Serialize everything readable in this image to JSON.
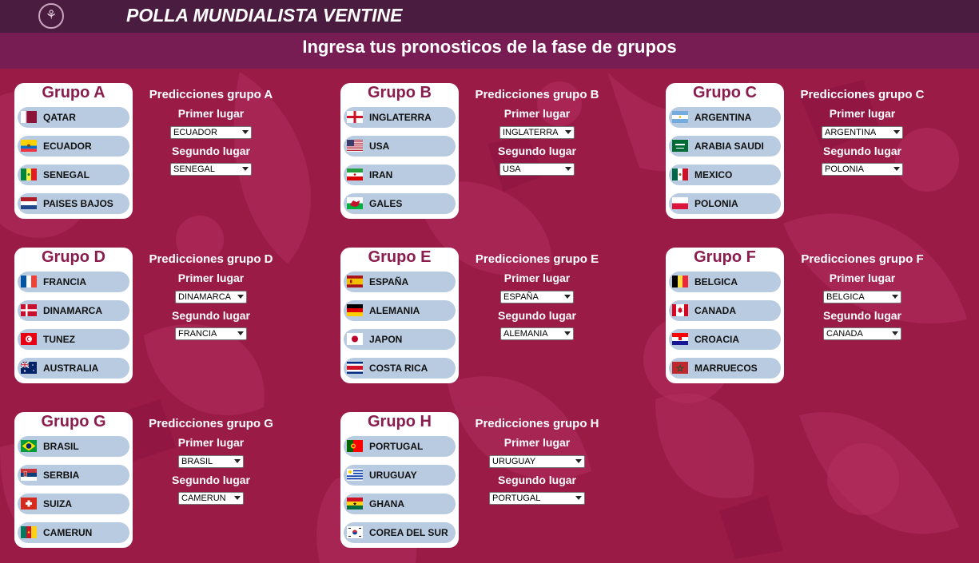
{
  "header": {
    "app_title": "POLLA MUNDIALISTA VENTINE",
    "logo_icon": "tulip-emblem-icon",
    "page_heading": "Ingresa tus pronosticos de la fase de grupos"
  },
  "labels": {
    "first_place": "Primer lugar",
    "second_place": "Segundo lugar"
  },
  "colors": {
    "top_bar": "#4a1c3f",
    "sub_bar": "#781c54",
    "background": "#9b1b47",
    "group_title": "#8a1d4e",
    "team_pill": "#b9cbe0"
  },
  "groups": [
    {
      "title": "Grupo A",
      "pred_title": "Predicciones grupo A",
      "teams": [
        {
          "name": "QATAR",
          "flag": "qatar-flag-icon"
        },
        {
          "name": "ECUADOR",
          "flag": "ecuador-flag-icon"
        },
        {
          "name": "SENEGAL",
          "flag": "senegal-flag-icon"
        },
        {
          "name": "PAISES BAJOS",
          "flag": "netherlands-flag-icon"
        }
      ],
      "first": "ECUADOR",
      "second": "SENEGAL"
    },
    {
      "title": "Grupo B",
      "pred_title": "Predicciones grupo B",
      "teams": [
        {
          "name": "INGLATERRA",
          "flag": "england-flag-icon"
        },
        {
          "name": "USA",
          "flag": "usa-flag-icon"
        },
        {
          "name": "IRAN",
          "flag": "iran-flag-icon"
        },
        {
          "name": "GALES",
          "flag": "wales-flag-icon"
        }
      ],
      "first": "INGLATERRA",
      "second": "USA"
    },
    {
      "title": "Grupo C",
      "pred_title": "Predicciones grupo C",
      "teams": [
        {
          "name": "ARGENTINA",
          "flag": "argentina-flag-icon"
        },
        {
          "name": "ARABIA SAUDI",
          "flag": "saudi-arabia-flag-icon"
        },
        {
          "name": "MEXICO",
          "flag": "mexico-flag-icon"
        },
        {
          "name": "POLONIA",
          "flag": "poland-flag-icon"
        }
      ],
      "first": "ARGENTINA",
      "second": "POLONIA"
    },
    {
      "title": "Grupo D",
      "pred_title": "Predicciones grupo D",
      "teams": [
        {
          "name": "FRANCIA",
          "flag": "france-flag-icon"
        },
        {
          "name": "DINAMARCA",
          "flag": "denmark-flag-icon"
        },
        {
          "name": "TUNEZ",
          "flag": "tunisia-flag-icon"
        },
        {
          "name": "AUSTRALIA",
          "flag": "australia-flag-icon"
        }
      ],
      "first": "DINAMARCA",
      "second": "FRANCIA"
    },
    {
      "title": "Grupo E",
      "pred_title": "Predicciones grupo E",
      "teams": [
        {
          "name": "ESPAÑA",
          "flag": "spain-flag-icon"
        },
        {
          "name": "ALEMANIA",
          "flag": "germany-flag-icon"
        },
        {
          "name": "JAPON",
          "flag": "japan-flag-icon"
        },
        {
          "name": "COSTA RICA",
          "flag": "costa-rica-flag-icon"
        }
      ],
      "first": "ESPAÑA",
      "second": "ALEMANIA"
    },
    {
      "title": "Grupo F",
      "pred_title": "Predicciones grupo F",
      "teams": [
        {
          "name": "BELGICA",
          "flag": "belgium-flag-icon"
        },
        {
          "name": "CANADA",
          "flag": "canada-flag-icon"
        },
        {
          "name": "CROACIA",
          "flag": "croatia-flag-icon"
        },
        {
          "name": "MARRUECOS",
          "flag": "morocco-flag-icon"
        }
      ],
      "first": "BELGICA",
      "second": "CANADA"
    },
    {
      "title": "Grupo G",
      "pred_title": "Predicciones grupo G",
      "teams": [
        {
          "name": "BRASIL",
          "flag": "brazil-flag-icon"
        },
        {
          "name": "SERBIA",
          "flag": "serbia-flag-icon"
        },
        {
          "name": "SUIZA",
          "flag": "switzerland-flag-icon"
        },
        {
          "name": "CAMERUN",
          "flag": "cameroon-flag-icon"
        }
      ],
      "first": "BRASIL",
      "second": "CAMERUN"
    },
    {
      "title": "Grupo H",
      "pred_title": "Predicciones grupo H",
      "teams": [
        {
          "name": "PORTUGAL",
          "flag": "portugal-flag-icon"
        },
        {
          "name": "URUGUAY",
          "flag": "uruguay-flag-icon"
        },
        {
          "name": "GHANA",
          "flag": "ghana-flag-icon"
        },
        {
          "name": "COREA DEL SUR",
          "flag": "south-korea-flag-icon"
        }
      ],
      "first": "URUGUAY",
      "second": "PORTUGAL"
    }
  ]
}
